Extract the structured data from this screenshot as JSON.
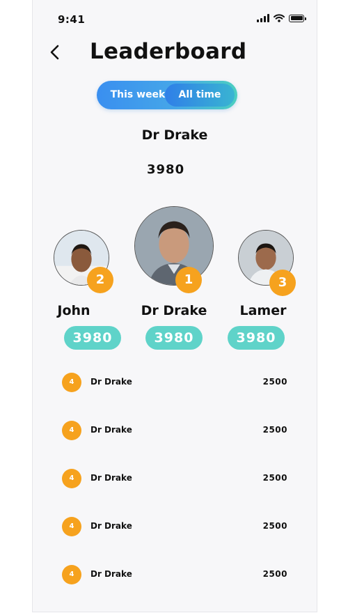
{
  "status_bar": {
    "time": "9:41"
  },
  "header": {
    "title": "Leaderboard"
  },
  "toggle": {
    "this_week": "This week",
    "all_time": "All time"
  },
  "top_player": {
    "name": "Dr Drake",
    "score": "3980"
  },
  "podium": [
    {
      "rank": "2",
      "name": "John",
      "score": "3980"
    },
    {
      "rank": "1",
      "name": "Dr Drake",
      "score": "3980"
    },
    {
      "rank": "3",
      "name": "Lamer",
      "score": "3980"
    }
  ],
  "list": [
    {
      "rank": "4",
      "name": "Dr Drake",
      "score": "2500"
    },
    {
      "rank": "4",
      "name": "Dr Drake",
      "score": "2500"
    },
    {
      "rank": "4",
      "name": "Dr Drake",
      "score": "2500"
    },
    {
      "rank": "4",
      "name": "Dr Drake",
      "score": "2500"
    },
    {
      "rank": "4",
      "name": "Dr Drake",
      "score": "2500"
    }
  ],
  "colors": {
    "accent_orange": "#f6a21e",
    "score_pill": "#5fd3c9",
    "toggle_start": "#3a8ff0",
    "toggle_end": "#4ccfc0"
  },
  "icons": [
    "back-arrow-icon",
    "cellular-signal-icon",
    "wifi-icon",
    "battery-icon"
  ]
}
